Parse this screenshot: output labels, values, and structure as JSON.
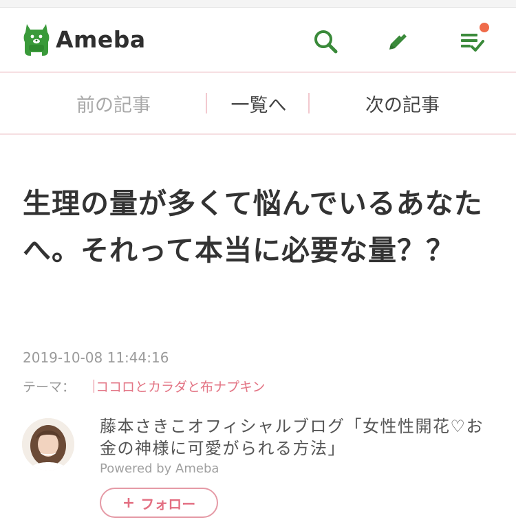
{
  "header": {
    "logo_text": "Ameba",
    "icons": [
      "search-icon",
      "pencil-icon",
      "feed-icon"
    ],
    "accent_color": "#3a8a3a",
    "notification_color": "#ef6b4a"
  },
  "pager": {
    "prev": "前の記事",
    "list": "一覧へ",
    "next": "次の記事"
  },
  "article": {
    "title": "生理の量が多くて悩んでいるあなたへ。それって本当に必要な量？？",
    "datetime": "2019-10-08 11:44:16",
    "theme_label": "テーマ：",
    "theme_value": "ココロとカラダと布ナプキン"
  },
  "blog": {
    "name": "藤本さきこオフィシャルブログ「女性性開花♡お金の神様に可愛がられる方法」",
    "powered_by": "Powered by Ameba",
    "follow_label": "フォロー",
    "follow_plus": "+",
    "follow_color": "#e36f82"
  }
}
